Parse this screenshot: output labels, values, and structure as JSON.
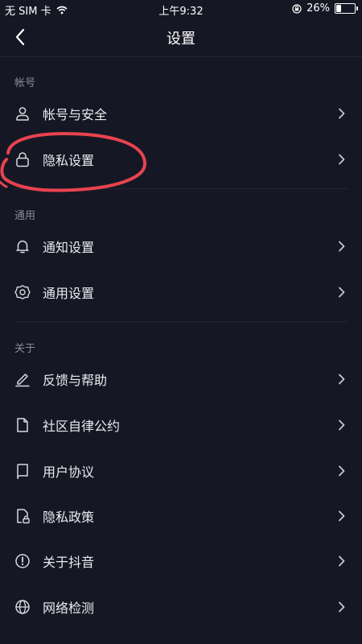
{
  "status_bar": {
    "carrier": "无 SIM 卡",
    "time": "上午9:32",
    "battery_percent": "26%",
    "battery_level": 0.26
  },
  "nav": {
    "title": "设置"
  },
  "sections": [
    {
      "header": "帐号",
      "items": [
        {
          "label": "帐号与安全",
          "icon": "user-icon"
        },
        {
          "label": "隐私设置",
          "icon": "lock-icon"
        }
      ]
    },
    {
      "header": "通用",
      "items": [
        {
          "label": "通知设置",
          "icon": "bell-icon"
        },
        {
          "label": "通用设置",
          "icon": "gear-icon"
        }
      ]
    },
    {
      "header": "关于",
      "items": [
        {
          "label": "反馈与帮助",
          "icon": "edit-icon"
        },
        {
          "label": "社区自律公约",
          "icon": "document-icon"
        },
        {
          "label": "用户协议",
          "icon": "book-icon"
        },
        {
          "label": "隐私政策",
          "icon": "lock-document-icon"
        },
        {
          "label": "关于抖音",
          "icon": "info-icon"
        },
        {
          "label": "网络检测",
          "icon": "globe-icon"
        }
      ]
    }
  ],
  "colors": {
    "background": "#161724",
    "annotation": "#e8434f"
  }
}
